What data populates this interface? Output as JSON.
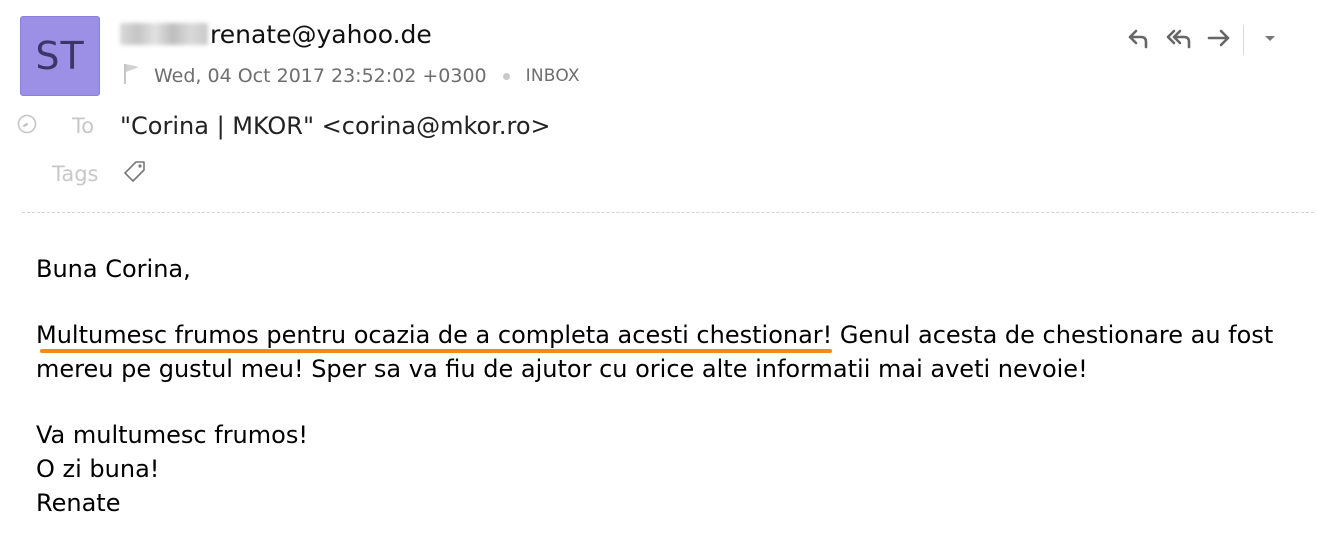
{
  "email": {
    "avatar_initials": "ST",
    "sender_email": "renate@yahoo.de",
    "date": "Wed, 04 Oct 2017 23:52:02 +0300",
    "folder": "INBOX",
    "to_label": "To",
    "to_value": "\"Corina | MKOR\" <corina@mkor.ro>",
    "tags_label": "Tags"
  },
  "body": {
    "greeting": "Buna Corina,",
    "highlighted": "Multumesc frumos pentru ocazia de a completa acesti chestionar!",
    "rest_line1": " Genul acesta de chestionare au fost",
    "line2": "mereu pe gustul meu! Sper sa va fiu de ajutor cu orice alte informatii mai aveti nevoie!",
    "closing1": "Va multumesc frumos!",
    "closing2": "O zi buna!",
    "signature": "Renate"
  },
  "icons": {
    "reply": "reply-icon",
    "reply_all": "reply-all-icon",
    "forward": "forward-icon",
    "more": "chevron-down-icon",
    "flag": "flag-icon",
    "clock": "clock-icon",
    "tag": "tag-icon"
  },
  "colors": {
    "avatar_bg": "#9b8fe6",
    "highlight": "#f08a1c"
  }
}
